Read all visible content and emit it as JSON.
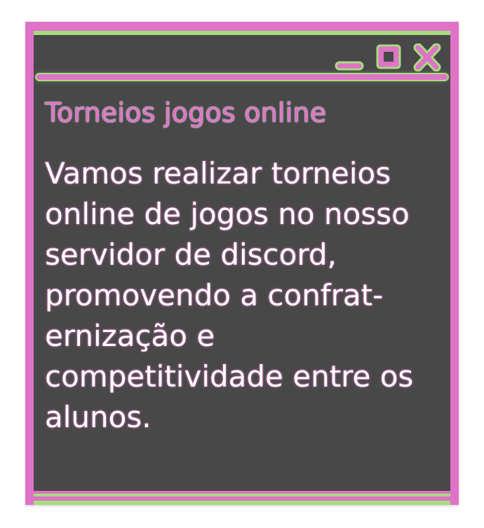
{
  "window": {
    "title": "Torneios jogos online",
    "body_lines": [
      "Vamos realizar torneios",
      "online de jogos no nosso",
      "servidor de discord,",
      "promovendo a confrat-",
      "ernização e",
      "competitividade entre os",
      "alunos."
    ]
  },
  "icons": {
    "minimize": "minimize-icon",
    "maximize": "maximize-icon",
    "close": "close-icon"
  },
  "colors": {
    "frame": "#df73c7",
    "accent": "#a6dd7f",
    "background": "#484848",
    "text": "#ffffff"
  }
}
